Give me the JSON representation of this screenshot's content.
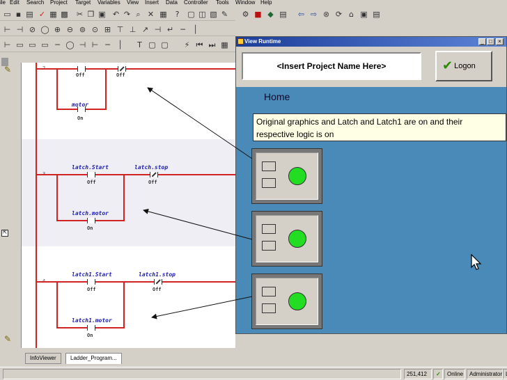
{
  "menu": [
    "ile",
    "Edit",
    "Search",
    "Project",
    "Target",
    "Variables",
    "View",
    "Insert",
    "Data",
    "Controller",
    "Tools",
    "Window",
    "Help"
  ],
  "ladder": {
    "rungs": [
      {
        "number": "2",
        "contacts": [
          {
            "state": "Off"
          },
          {
            "state": "Off"
          }
        ],
        "branch": {
          "tag": "motor",
          "state": "On"
        }
      },
      {
        "number": "3",
        "contacts": [
          {
            "tag": "latch.Start",
            "state": "Off"
          },
          {
            "tag": "latch.stop",
            "state": "Off"
          }
        ],
        "branch": {
          "tag": "latch.motor",
          "state": "On"
        }
      },
      {
        "number": "4",
        "contacts": [
          {
            "tag": "latch1.Start",
            "state": "Off"
          },
          {
            "tag": "latch1.stop",
            "state": "Off"
          }
        ],
        "branch": {
          "tag": "latch1.motor",
          "state": "On"
        }
      }
    ],
    "rail_color": "#d22222"
  },
  "tabs": {
    "infoviewer": "InfoViewer",
    "ladder": "Ladder_Program..."
  },
  "status": {
    "coords": "251,412",
    "mode": "Online",
    "user": "Administrator",
    "extra": "L"
  },
  "runtime": {
    "title": "View Runtime",
    "project_name": "<Insert Project Name Here>",
    "logon_label": "Logon",
    "home_label": "Home",
    "note": "Original graphics and Latch and Latch1 are on and their respective logic is on",
    "panels": [
      {
        "led_color": "#22dd22"
      },
      {
        "led_color": "#22dd22"
      },
      {
        "led_color": "#22dd22"
      }
    ],
    "body_color": "#4a8ab8"
  }
}
